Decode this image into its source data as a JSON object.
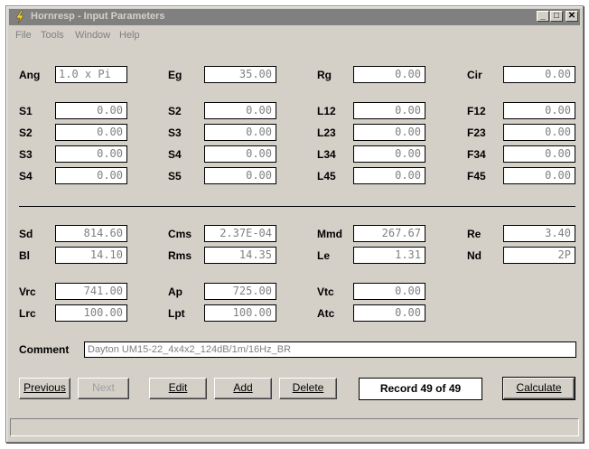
{
  "window": {
    "title": "Hornresp - Input Parameters",
    "controls": {
      "minimize": "_",
      "maximize": "□",
      "close": "✕"
    }
  },
  "menu": [
    "File",
    "Tools",
    "Window",
    "Help"
  ],
  "params": {
    "Ang": "1.0 x Pi",
    "Eg": "35.00",
    "Rg": "0.00",
    "Cir": "0.00",
    "S1": "0.00",
    "S2": "0.00",
    "S3": "0.00",
    "S4": "0.00",
    "S5": "0.00",
    "L12": "0.00",
    "L23": "0.00",
    "L34": "0.00",
    "L45": "0.00",
    "F12": "0.00",
    "F23": "0.00",
    "F34": "0.00",
    "F45": "0.00",
    "Sd": "814.60",
    "Bl": "14.10",
    "Cms": "2.37E-04",
    "Rms": "14.35",
    "Mmd": "267.67",
    "Le": "1.31",
    "Re": "3.40",
    "Nd": "2P",
    "Vrc": "741.00",
    "Lrc": "100.00",
    "Ap": "725.00",
    "Lpt": "100.00",
    "Vtc": "0.00",
    "Atc": "0.00"
  },
  "labels": {
    "Ang": "Ang",
    "Eg": "Eg",
    "Rg": "Rg",
    "Cir": "Cir",
    "S1": "S1",
    "S2": "S2",
    "S3": "S3",
    "S4": "S4",
    "S5": "S5",
    "L12": "L12",
    "L23": "L23",
    "L34": "L34",
    "L45": "L45",
    "F12": "F12",
    "F23": "F23",
    "F34": "F34",
    "F45": "F45",
    "Sd": "Sd",
    "Bl": "Bl",
    "Cms": "Cms",
    "Rms": "Rms",
    "Mmd": "Mmd",
    "Le": "Le",
    "Re": "Re",
    "Nd": "Nd",
    "Vrc": "Vrc",
    "Lrc": "Lrc",
    "Ap": "Ap",
    "Lpt": "Lpt",
    "Vtc": "Vtc",
    "Atc": "Atc",
    "Comment": "Comment"
  },
  "comment": "Dayton UM15-22_4x4x2_124dB/1m/16Hz_BR",
  "buttons": {
    "previous": "Previous",
    "next": "Next",
    "edit": "Edit",
    "add": "Add",
    "delete": "Delete",
    "calculate": "Calculate"
  },
  "record": "Record 49 of 49",
  "icons": {
    "app": "lightning-bolt-icon"
  }
}
